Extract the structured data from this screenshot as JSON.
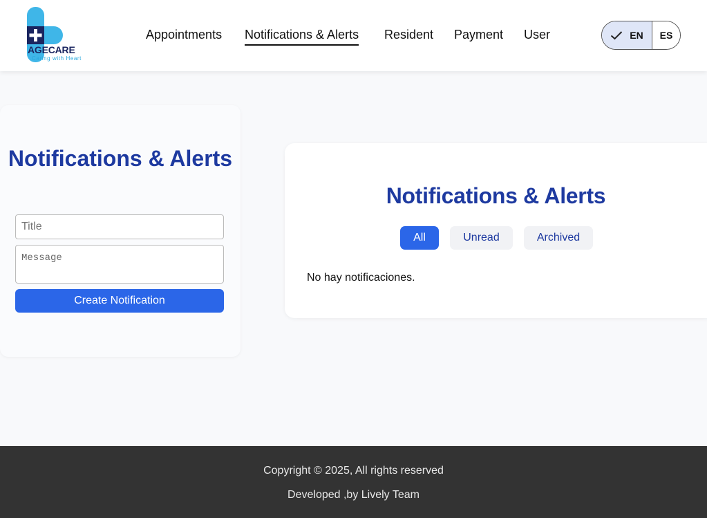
{
  "brand": {
    "name": "AGECARE",
    "tagline": "Caring with Heart",
    "colors": {
      "navy": "#1a2560",
      "sky": "#2aa8dd"
    }
  },
  "nav": {
    "items": [
      {
        "label": "Appointments",
        "active": false
      },
      {
        "label": "Notifications & Alerts",
        "active": true
      },
      {
        "label": "Resident",
        "active": false
      },
      {
        "label": "Payment",
        "active": false
      },
      {
        "label": "User",
        "active": false
      }
    ]
  },
  "language": {
    "options": [
      {
        "label": "EN",
        "selected": true
      },
      {
        "label": "ES",
        "selected": false
      }
    ]
  },
  "create_form": {
    "heading": "Notifications & Alerts",
    "title_placeholder": "Title",
    "title_value": "",
    "message_placeholder": "Message",
    "message_value": "",
    "submit_label": "Create Notification"
  },
  "list_panel": {
    "heading": "Notifications & Alerts",
    "tabs": [
      {
        "label": "All",
        "active": true
      },
      {
        "label": "Unread",
        "active": false
      },
      {
        "label": "Archived",
        "active": false
      }
    ],
    "empty_message": "No hay notificaciones."
  },
  "footer": {
    "copyright": "Copyright © 2025, All rights reserved",
    "credit": "Developed ,by Lively Team"
  },
  "theme": {
    "primary": "#2b66e8",
    "heading": "#1e3aa0",
    "footer_bg": "#333333",
    "page_bg": "#f8f9fb"
  }
}
